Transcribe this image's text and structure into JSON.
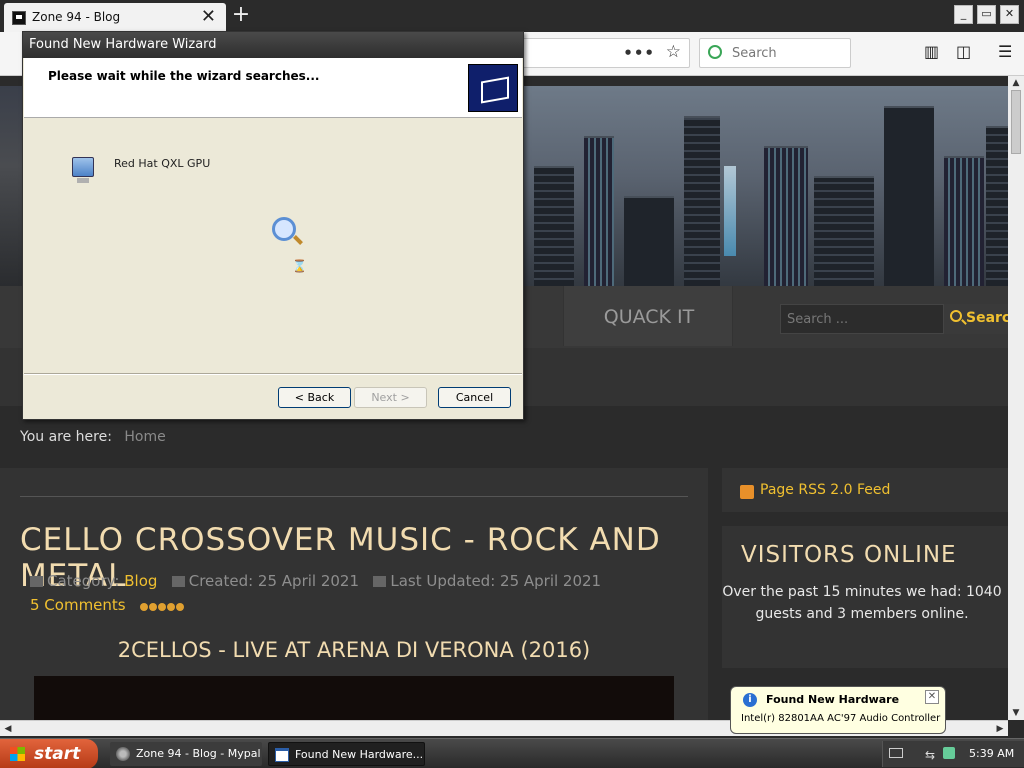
{
  "browser": {
    "tab_title": "Zone 94 - Blog",
    "tab_close": "✕",
    "new_tab": "+",
    "url_more": "•••",
    "search_placeholder": "Search",
    "window_buttons": {
      "minimize": "_",
      "maximize": "▭",
      "close": "✕"
    }
  },
  "site": {
    "menu_item": "QUACK IT",
    "search_placeholder": "Search ...",
    "search_button": "Search",
    "breadcrumb_prefix": "You are here:",
    "breadcrumb_home": "Home",
    "article": {
      "title": "CELLO CROSSOVER MUSIC - ROCK AND METAL",
      "category_label": "Category:",
      "category_value": "Blog",
      "created": "Created: 25 April 2021",
      "updated": "Last Updated: 25 April 2021",
      "comments": "5 Comments",
      "subheading": "2CELLOS - LIVE AT ARENA DI VERONA (2016)"
    },
    "rss_label": "Page RSS 2.0 Feed",
    "visitors": {
      "heading": "VISITORS ONLINE",
      "text": "Over the past 15 minutes we had: 1040 guests and 3 members online."
    }
  },
  "wizard": {
    "title": "Found New Hardware Wizard",
    "header_text": "Please wait while the wizard searches...",
    "device_name": "Red Hat QXL GPU",
    "back_label": "< Back",
    "next_label": "Next >",
    "cancel_label": "Cancel"
  },
  "notification": {
    "title": "Found New Hardware",
    "message": "Intel(r) 82801AA AC'97 Audio Controller",
    "close": "✕",
    "info_glyph": "i"
  },
  "taskbar": {
    "start_label": "start",
    "tasks": [
      {
        "label": "Zone 94 - Blog - Mypal"
      },
      {
        "label": "Found New Hardware..."
      }
    ],
    "clock": "5:39 AM"
  }
}
